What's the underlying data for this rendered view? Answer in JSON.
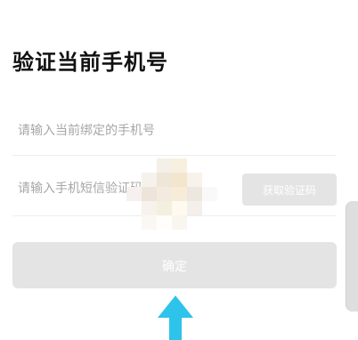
{
  "page": {
    "title": "验证当前手机号"
  },
  "form": {
    "phone_placeholder": "请输入当前绑定的手机号",
    "code_placeholder": "请输入手机短信验证码",
    "get_code_label": "获取验证码",
    "confirm_label": "确定"
  },
  "colors": {
    "title_text": "#111111",
    "placeholder_text": "#a7a7a7",
    "disabled_button_bg": "#e4e4e4",
    "button_text": "#ffffff",
    "pointer_arrow": "#2ec3ea"
  },
  "annotations": {
    "pointer": "arrow-up-icon",
    "obscured_area": "privacy-mosaic"
  }
}
